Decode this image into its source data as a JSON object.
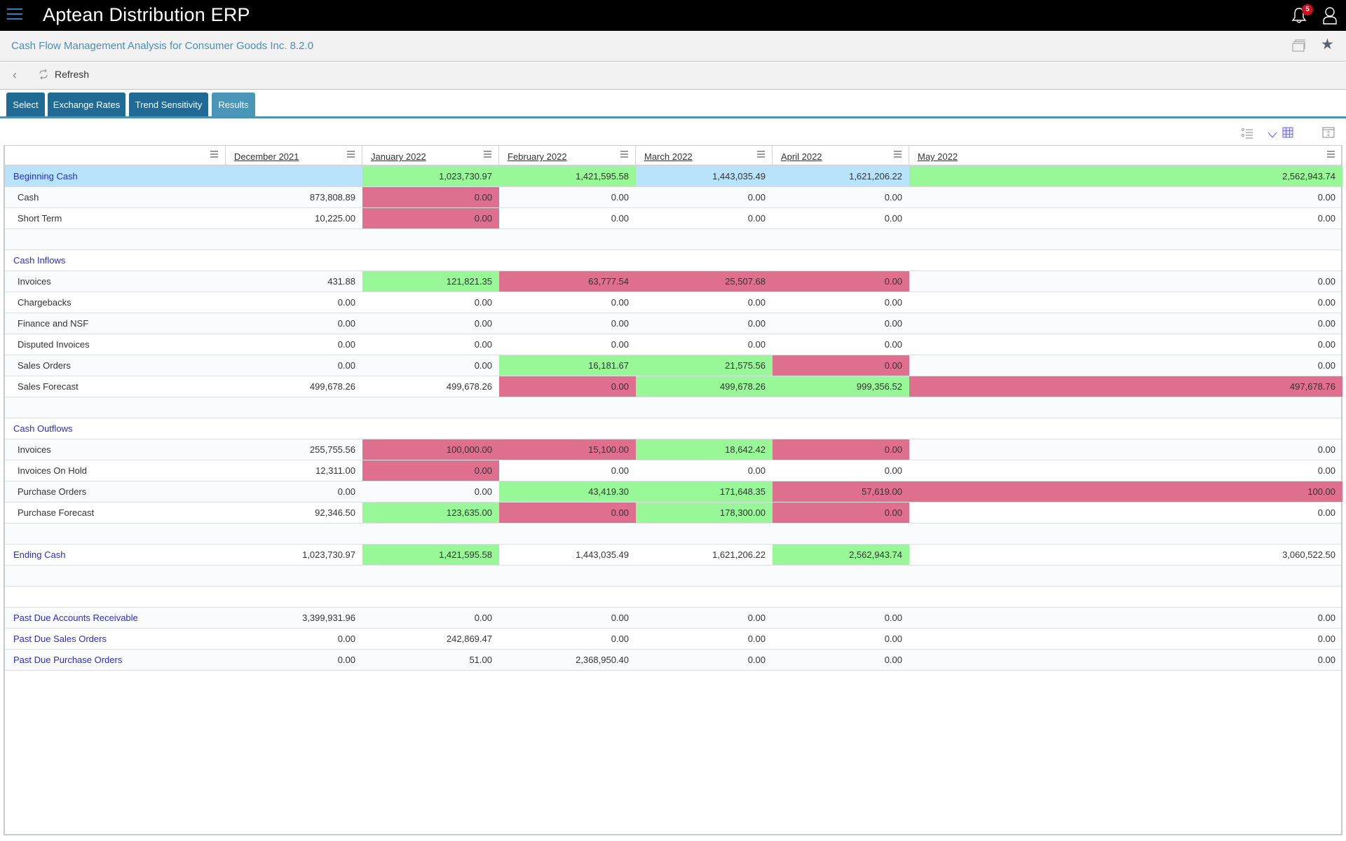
{
  "app": {
    "title": "Aptean Distribution ERP",
    "notifications_count": "5",
    "icons": {
      "menu": "hamburger-icon",
      "notifications": "bell-icon",
      "user": "user-icon"
    }
  },
  "page": {
    "title": "Cash Flow Management Analysis for Consumer Goods Inc. 8.2.0",
    "icons": {
      "window": "window-restore-icon",
      "favorite": "star-icon"
    }
  },
  "toolbar": {
    "back_icon": "chevron-left-icon",
    "refresh_label": "Refresh"
  },
  "tabs": [
    {
      "label": "Select",
      "active": false
    },
    {
      "label": "Exchange Rates",
      "active": false
    },
    {
      "label": "Trend Sensitivity",
      "active": false
    },
    {
      "label": "Results",
      "active": true
    }
  ],
  "grid_tools": [
    "list-settings-icon",
    "filter-dropdown-icon",
    "grid-view-icon",
    "fit-screen-icon"
  ],
  "colors": {
    "increase": "#98f898",
    "decrease": "#de6f8f",
    "highlight": "#b9e3fb",
    "link": "#2a2add",
    "tab": "#1f6b96",
    "tab_active": "#4a96b8"
  },
  "grid": {
    "columns": [
      "",
      "December 2021",
      "January 2022",
      "February 2022",
      "March 2022",
      "April 2022",
      "May 2022"
    ],
    "rows": [
      {
        "label": "Beginning Cash",
        "type": "section-hl",
        "values": [
          "",
          "1,023,730.97",
          "1,421,595.58",
          "1,443,035.49",
          "1,621,206.22",
          "2,562,943.74"
        ],
        "colors": [
          "b",
          "g",
          "g",
          "b",
          "b",
          "g"
        ]
      },
      {
        "label": "Cash",
        "type": "sub",
        "values": [
          "873,808.89",
          "0.00",
          "0.00",
          "0.00",
          "0.00",
          "0.00"
        ],
        "colors": [
          "",
          "r",
          "",
          "",
          "",
          ""
        ]
      },
      {
        "label": "Short Term",
        "type": "sub",
        "values": [
          "10,225.00",
          "0.00",
          "0.00",
          "0.00",
          "0.00",
          "0.00"
        ],
        "colors": [
          "",
          "r",
          "",
          "",
          "",
          ""
        ]
      },
      {
        "label": "",
        "type": "blank",
        "values": [
          "",
          "",
          "",
          "",
          "",
          ""
        ],
        "colors": [
          "",
          "",
          "",
          "",
          "",
          ""
        ]
      },
      {
        "label": "Cash Inflows",
        "type": "section",
        "values": [
          "",
          "",
          "",
          "",
          "",
          ""
        ],
        "colors": [
          "",
          "",
          "",
          "",
          "",
          ""
        ]
      },
      {
        "label": "Invoices",
        "type": "sub",
        "values": [
          "431.88",
          "121,821.35",
          "63,777.54",
          "25,507.68",
          "0.00",
          "0.00"
        ],
        "colors": [
          "",
          "g",
          "r",
          "r",
          "r",
          ""
        ]
      },
      {
        "label": "Chargebacks",
        "type": "sub",
        "values": [
          "0.00",
          "0.00",
          "0.00",
          "0.00",
          "0.00",
          "0.00"
        ],
        "colors": [
          "",
          "",
          "",
          "",
          "",
          ""
        ]
      },
      {
        "label": "Finance and NSF",
        "type": "sub",
        "values": [
          "0.00",
          "0.00",
          "0.00",
          "0.00",
          "0.00",
          "0.00"
        ],
        "colors": [
          "",
          "",
          "",
          "",
          "",
          ""
        ]
      },
      {
        "label": "Disputed Invoices",
        "type": "sub",
        "values": [
          "0.00",
          "0.00",
          "0.00",
          "0.00",
          "0.00",
          "0.00"
        ],
        "colors": [
          "",
          "",
          "",
          "",
          "",
          ""
        ]
      },
      {
        "label": "Sales Orders",
        "type": "sub",
        "values": [
          "0.00",
          "0.00",
          "16,181.67",
          "21,575.56",
          "0.00",
          "0.00"
        ],
        "colors": [
          "",
          "",
          "g",
          "g",
          "r",
          ""
        ]
      },
      {
        "label": "Sales Forecast",
        "type": "sub",
        "values": [
          "499,678.26",
          "499,678.26",
          "0.00",
          "499,678.26",
          "999,356.52",
          "497,678.76"
        ],
        "colors": [
          "",
          "",
          "r",
          "g",
          "g",
          "r"
        ]
      },
      {
        "label": "",
        "type": "blank",
        "values": [
          "",
          "",
          "",
          "",
          "",
          ""
        ],
        "colors": [
          "",
          "",
          "",
          "",
          "",
          ""
        ]
      },
      {
        "label": "Cash Outflows",
        "type": "section",
        "values": [
          "",
          "",
          "",
          "",
          "",
          ""
        ],
        "colors": [
          "",
          "",
          "",
          "",
          "",
          ""
        ]
      },
      {
        "label": "Invoices",
        "type": "sub",
        "values": [
          "255,755.56",
          "100,000.00",
          "15,100.00",
          "18,642.42",
          "0.00",
          "0.00"
        ],
        "colors": [
          "",
          "r",
          "r",
          "g",
          "r",
          ""
        ]
      },
      {
        "label": "Invoices On Hold",
        "type": "sub",
        "values": [
          "12,311.00",
          "0.00",
          "0.00",
          "0.00",
          "0.00",
          "0.00"
        ],
        "colors": [
          "",
          "r",
          "",
          "",
          "",
          ""
        ]
      },
      {
        "label": "Purchase Orders",
        "type": "sub",
        "values": [
          "0.00",
          "0.00",
          "43,419.30",
          "171,648.35",
          "57,619.00",
          "100.00"
        ],
        "colors": [
          "",
          "",
          "g",
          "g",
          "r",
          "r"
        ]
      },
      {
        "label": "Purchase Forecast",
        "type": "sub",
        "values": [
          "92,346.50",
          "123,635.00",
          "0.00",
          "178,300.00",
          "0.00",
          "0.00"
        ],
        "colors": [
          "",
          "g",
          "r",
          "g",
          "r",
          ""
        ]
      },
      {
        "label": "",
        "type": "blank",
        "values": [
          "",
          "",
          "",
          "",
          "",
          ""
        ],
        "colors": [
          "",
          "",
          "",
          "",
          "",
          ""
        ]
      },
      {
        "label": "Ending Cash",
        "type": "section",
        "values": [
          "1,023,730.97",
          "1,421,595.58",
          "1,443,035.49",
          "1,621,206.22",
          "2,562,943.74",
          "3,060,522.50"
        ],
        "colors": [
          "",
          "g",
          "",
          "",
          "g",
          ""
        ]
      },
      {
        "label": "",
        "type": "blank",
        "values": [
          "",
          "",
          "",
          "",
          "",
          ""
        ],
        "colors": [
          "",
          "",
          "",
          "",
          "",
          ""
        ]
      },
      {
        "label": "",
        "type": "blank",
        "values": [
          "",
          "",
          "",
          "",
          "",
          ""
        ],
        "colors": [
          "",
          "",
          "",
          "",
          "",
          ""
        ]
      },
      {
        "label": "Past Due Accounts Receivable",
        "type": "section",
        "values": [
          "3,399,931.96",
          "0.00",
          "0.00",
          "0.00",
          "0.00",
          "0.00"
        ],
        "colors": [
          "",
          "",
          "",
          "",
          "",
          ""
        ]
      },
      {
        "label": "Past Due Sales Orders",
        "type": "section",
        "values": [
          "0.00",
          "242,869.47",
          "0.00",
          "0.00",
          "0.00",
          "0.00"
        ],
        "colors": [
          "",
          "",
          "",
          "",
          "",
          ""
        ]
      },
      {
        "label": "Past Due Purchase Orders",
        "type": "section",
        "values": [
          "0.00",
          "51.00",
          "2,368,950.40",
          "0.00",
          "0.00",
          "0.00"
        ],
        "colors": [
          "",
          "",
          "",
          "",
          "",
          ""
        ]
      }
    ]
  }
}
